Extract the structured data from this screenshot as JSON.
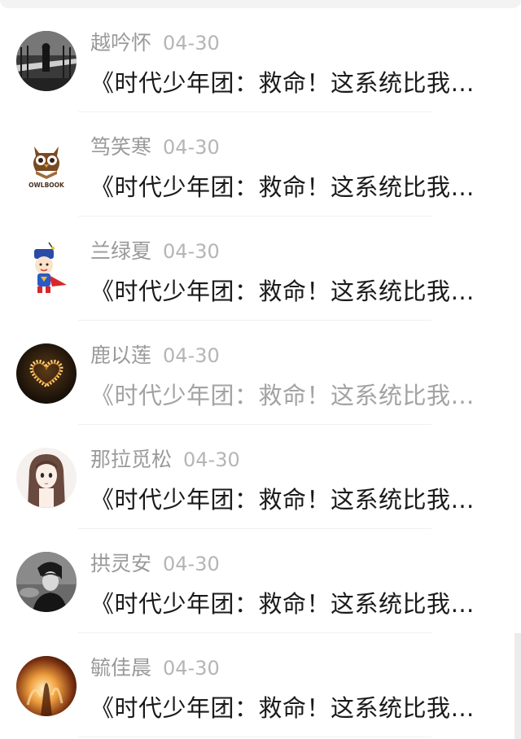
{
  "messages": [
    {
      "user": "越吟怀",
      "date": "04-30",
      "title": "《时代少年团：救命！这系统比我…",
      "read": false,
      "avatar": "dark-bridge-photo"
    },
    {
      "user": "笃笑寒",
      "date": "04-30",
      "title": "《时代少年团：救命！这系统比我…",
      "read": false,
      "avatar": "owlbook-logo",
      "avatar_text": "OWLBOOK"
    },
    {
      "user": "兰绿夏",
      "date": "04-30",
      "title": "《时代少年团：救命！这系统比我…",
      "read": false,
      "avatar": "cartoon-superhero"
    },
    {
      "user": "鹿以莲",
      "date": "04-30",
      "title": "《时代少年团：救命！这系统比我…",
      "read": true,
      "avatar": "candle-heart-photo"
    },
    {
      "user": "那拉觅松",
      "date": "04-30",
      "title": "《时代少年团：救命！这系统比我…",
      "read": false,
      "avatar": "anime-girl-drawing"
    },
    {
      "user": "拱灵安",
      "date": "04-30",
      "title": "《时代少年团：救命！这系统比我…",
      "read": false,
      "avatar": "bw-portrait-photo"
    },
    {
      "user": "毓佳晨",
      "date": "04-30",
      "title": "《时代少年团：救命！这系统比我…",
      "read": false,
      "avatar": "fire-photo"
    }
  ],
  "colors": {
    "name": "#9a9a9a",
    "date": "#b5b5b5",
    "title_unread": "#1a1a1a",
    "title_read": "#a3a3a3"
  }
}
